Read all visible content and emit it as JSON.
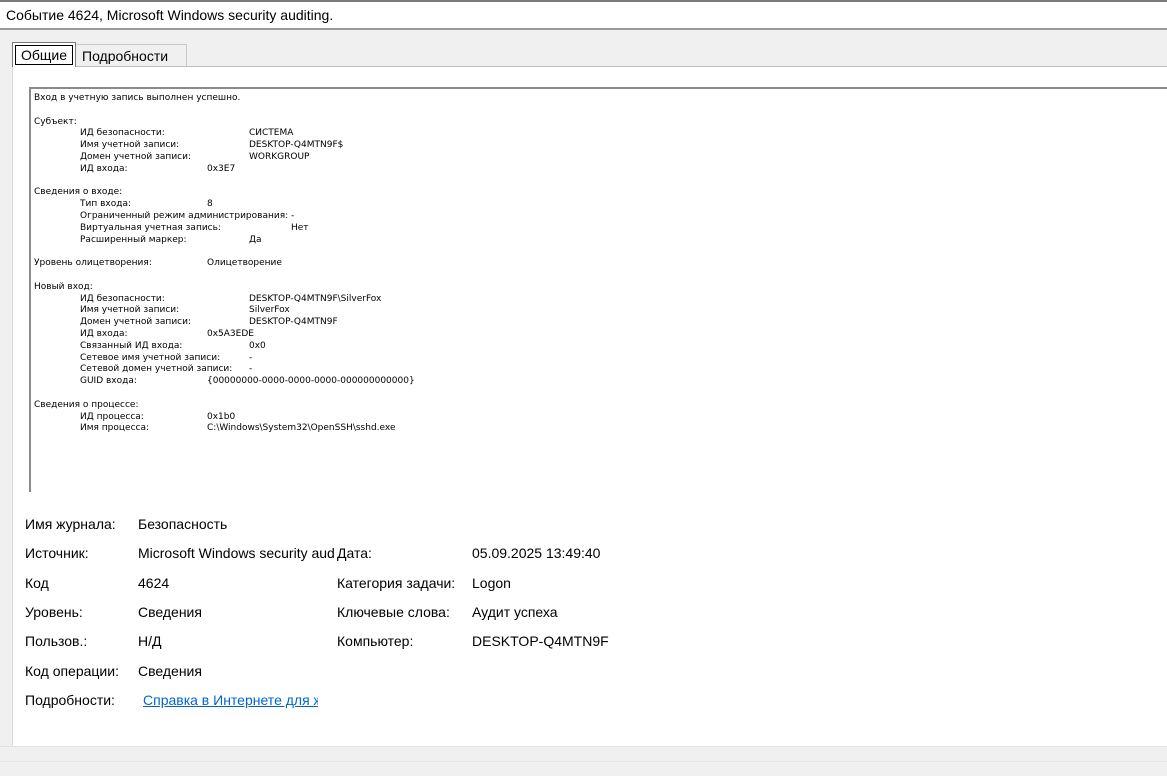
{
  "window": {
    "title": "Событие 4624, Microsoft Windows security auditing."
  },
  "tabs": [
    {
      "label": "Общие",
      "active": true
    },
    {
      "label": "Подробности",
      "active": false
    }
  ],
  "message": {
    "lines": [
      {
        "label": "Вход в учетную запись выполнен успешно.",
        "value": "",
        "indent": 0,
        "value_col": 0
      },
      {
        "label": "",
        "value": "",
        "indent": 0,
        "value_col": 0
      },
      {
        "label": "Субъект:",
        "value": "",
        "indent": 0,
        "value_col": 0
      },
      {
        "label": "ИД безопасности:",
        "value": "СИСТЕМА",
        "indent": 1,
        "value_col": 3
      },
      {
        "label": "Имя учетной записи:",
        "value": "DESKTOP-Q4MTN9F$",
        "indent": 1,
        "value_col": 3
      },
      {
        "label": "Домен учетной записи:",
        "value": "WORKGROUP",
        "indent": 1,
        "value_col": 3
      },
      {
        "label": "ИД входа:",
        "value": "0x3E7",
        "indent": 1,
        "value_col": 2
      },
      {
        "label": "",
        "value": "",
        "indent": 0,
        "value_col": 0
      },
      {
        "label": "Сведения о входе:",
        "value": "",
        "indent": 0,
        "value_col": 0
      },
      {
        "label": "Тип входа:",
        "value": "8",
        "indent": 1,
        "value_col": 2
      },
      {
        "label": "Ограниченный режим администрирования:",
        "value": "-",
        "indent": 1,
        "value_col": 5
      },
      {
        "label": "Виртуальная учетная запись:",
        "value": "Нет",
        "indent": 1,
        "value_col": 4
      },
      {
        "label": "Расширенный маркер:",
        "value": "Да",
        "indent": 1,
        "value_col": 3
      },
      {
        "label": "",
        "value": "",
        "indent": 0,
        "value_col": 0
      },
      {
        "label": "Уровень олицетворения:",
        "value": "Олицетворение",
        "indent": 0,
        "value_col": 2
      },
      {
        "label": "",
        "value": "",
        "indent": 0,
        "value_col": 0
      },
      {
        "label": "Новый вход:",
        "value": "",
        "indent": 0,
        "value_col": 0
      },
      {
        "label": "ИД безопасности:",
        "value": "DESKTOP-Q4MTN9F\\SilverFox",
        "indent": 1,
        "value_col": 3
      },
      {
        "label": "Имя учетной записи:",
        "value": "SilverFox",
        "indent": 1,
        "value_col": 3
      },
      {
        "label": "Домен учетной записи:",
        "value": "DESKTOP-Q4MTN9F",
        "indent": 1,
        "value_col": 3
      },
      {
        "label": "ИД входа:",
        "value": "0x5A3EDE",
        "indent": 1,
        "value_col": 2
      },
      {
        "label": "Связанный ИД входа:",
        "value": "0x0",
        "indent": 1,
        "value_col": 3
      },
      {
        "label": "Сетевое имя учетной записи:",
        "value": "-",
        "indent": 1,
        "value_col": 3
      },
      {
        "label": "Сетевой домен учетной записи:",
        "value": "-",
        "indent": 1,
        "value_col": 3
      },
      {
        "label": "GUID входа:",
        "value": "{00000000-0000-0000-0000-000000000000}",
        "indent": 1,
        "value_col": 2
      },
      {
        "label": "",
        "value": "",
        "indent": 0,
        "value_col": 0
      },
      {
        "label": "Сведения о процессе:",
        "value": "",
        "indent": 0,
        "value_col": 0
      },
      {
        "label": "ИД процесса:",
        "value": "0x1b0",
        "indent": 1,
        "value_col": 2
      },
      {
        "label": "Имя процесса:",
        "value": "C:\\Windows\\System32\\OpenSSH\\sshd.exe",
        "indent": 1,
        "value_col": 2
      }
    ]
  },
  "properties": {
    "log_name_label": "Имя журнала:",
    "log_name_value": "Безопасность",
    "source_label": "Источник:",
    "source_value": "Microsoft Windows security auditing.",
    "date_label": "Дата:",
    "date_value": "05.09.2025 13:49:40",
    "code_label": "Код",
    "code_value": "4624",
    "task_category_label": "Категория задачи:",
    "task_category_value": "Logon",
    "level_label": "Уровень:",
    "level_value": "Сведения",
    "keywords_label": "Ключевые слова:",
    "keywords_value": "Аудит успеха",
    "user_label": "Пользов.:",
    "user_value": "Н/Д",
    "computer_label": "Компьютер:",
    "computer_value": "DESKTOP-Q4MTN9F",
    "opcode_label": "Код операции:",
    "opcode_value": "Сведения",
    "more_info_label": "Подробности:",
    "more_info_link": "Справка в Интернете для журнала"
  }
}
